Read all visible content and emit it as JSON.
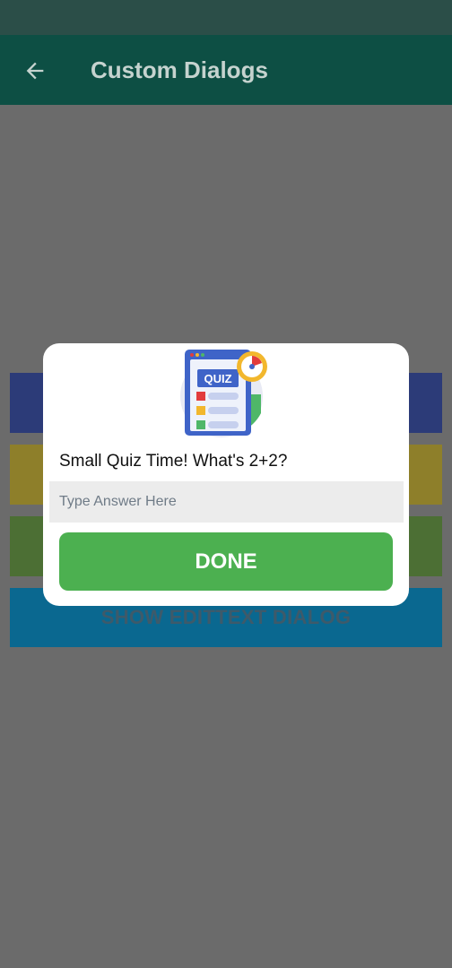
{
  "app_bar": {
    "title": "Custom Dialogs"
  },
  "background_buttons": [
    {
      "label": "",
      "color": "#2c3b78"
    },
    {
      "label": "",
      "color": "#8e7f2a"
    },
    {
      "label": "",
      "color": "#4c6f34"
    },
    {
      "label": "SHOW EDITTEXT DIALOG",
      "color": "#0a6890"
    }
  ],
  "dialog": {
    "icon": "quiz-icon",
    "icon_text": "QUIZ",
    "question": "Small Quiz Time! What's 2+2?",
    "input_placeholder": "Type Answer Here",
    "input_value": "",
    "done_label": "DONE"
  },
  "colors": {
    "accent_green": "#4cb050",
    "app_bar": "#0d4f44",
    "scrim_bg": "#6b6b6b"
  }
}
